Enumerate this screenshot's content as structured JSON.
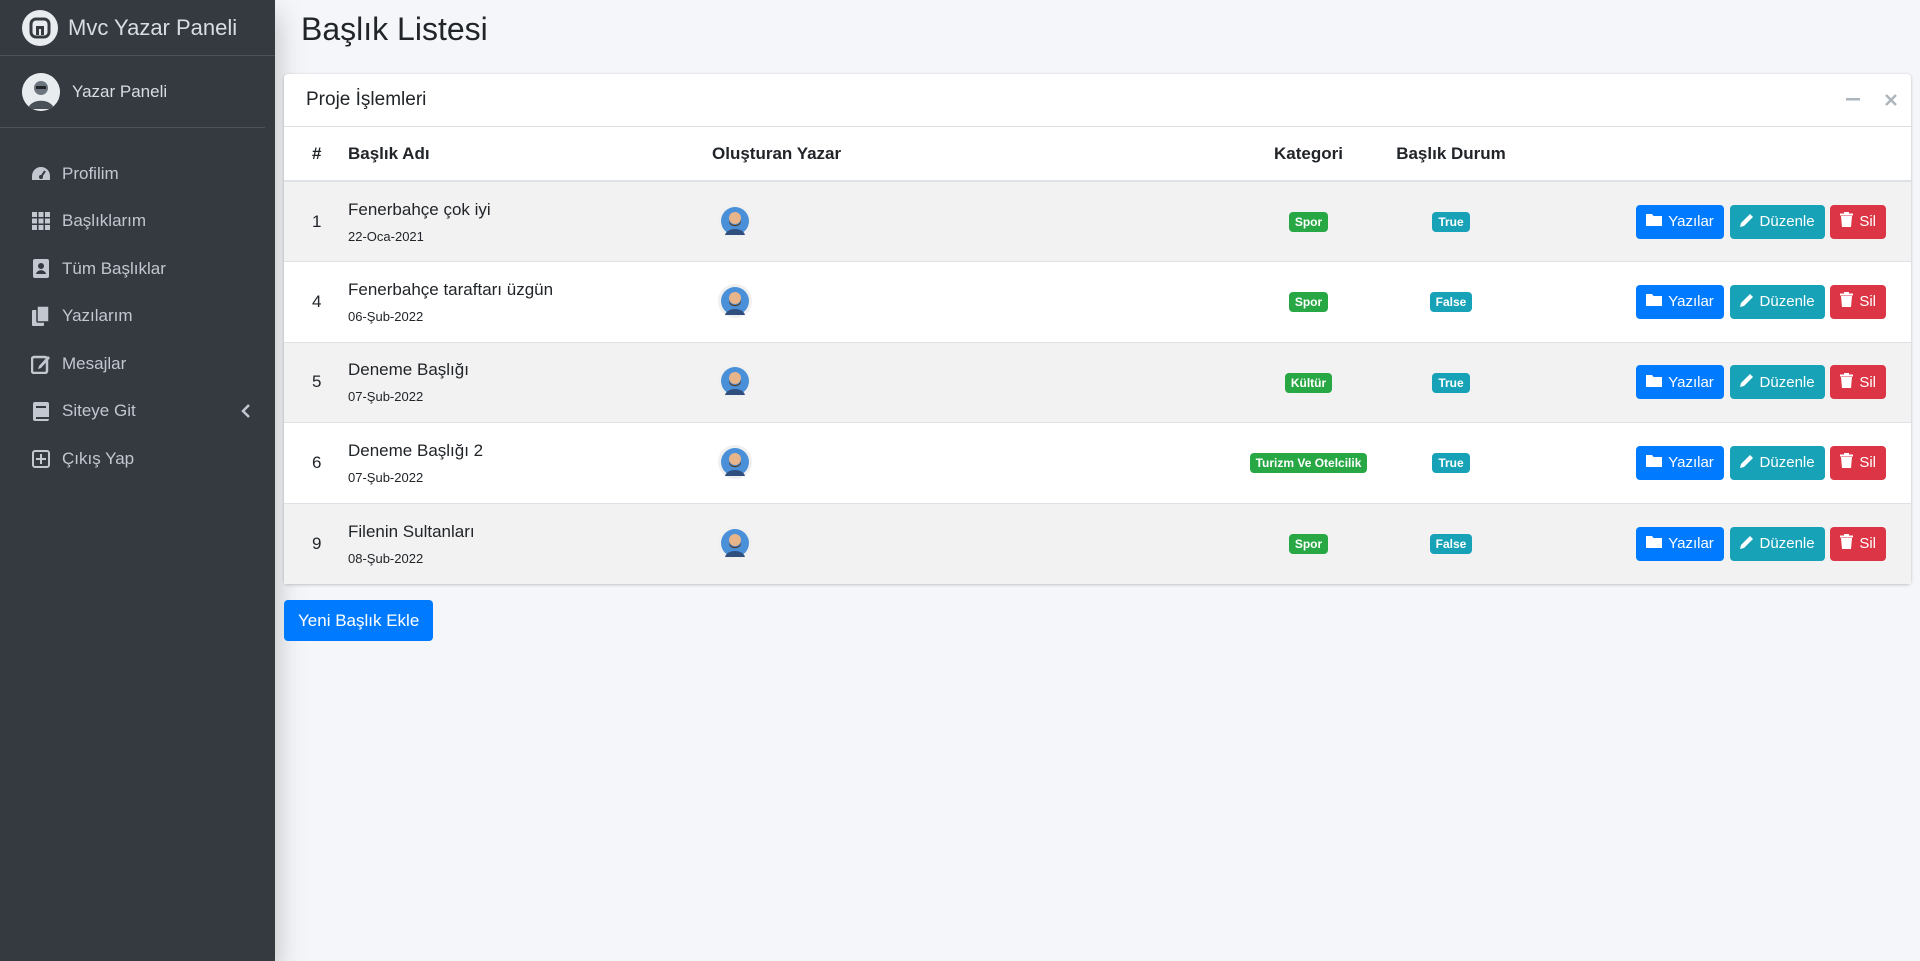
{
  "brand": {
    "title": "Mvc Yazar Paneli",
    "logo_icon": "brand-logo-icon"
  },
  "user": {
    "name": "Yazar Paneli",
    "avatar_icon": "user-avatar"
  },
  "sidebar": {
    "items": [
      {
        "label": "Profilim",
        "icon": "tachometer-icon"
      },
      {
        "label": "Başlıklarım",
        "icon": "grid-icon"
      },
      {
        "label": "Tüm Başlıklar",
        "icon": "contact-book-icon"
      },
      {
        "label": "Yazılarım",
        "icon": "copy-icon"
      },
      {
        "label": "Mesajlar",
        "icon": "edit-icon"
      },
      {
        "label": "Siteye Git",
        "icon": "book-icon",
        "caret": "chevron-left-icon"
      },
      {
        "label": "Çıkış Yap",
        "icon": "plus-square-icon"
      }
    ]
  },
  "page": {
    "title": "Başlık Listesi"
  },
  "card": {
    "title": "Proje İşlemleri",
    "tools": [
      "minus-icon",
      "close-icon"
    ],
    "headers": [
      "#",
      "Başlık Adı",
      "Oluşturan Yazar",
      "Kategori",
      "Başlık Durum"
    ],
    "rows": [
      {
        "id": "1",
        "title": "Fenerbahçe çok iyi",
        "date": "22-Oca-2021",
        "category": "Spor",
        "status": "True"
      },
      {
        "id": "4",
        "title": "Fenerbahçe taraftarı üzgün",
        "date": "06-Şub-2022",
        "category": "Spor",
        "status": "False"
      },
      {
        "id": "5",
        "title": "Deneme Başlığı",
        "date": "07-Şub-2022",
        "category": "Kültür",
        "status": "True"
      },
      {
        "id": "6",
        "title": "Deneme Başlığı 2",
        "date": "07-Şub-2022",
        "category": "Turizm Ve Otelcilik",
        "status": "True"
      },
      {
        "id": "9",
        "title": "Filenin Sultanları",
        "date": "08-Şub-2022",
        "category": "Spor",
        "status": "False"
      }
    ],
    "actions": {
      "posts": "Yazılar",
      "edit": "Düzenle",
      "delete": "Sil"
    }
  },
  "new_button": "Yeni Başlık Ekle",
  "colors": {
    "sidebar": "#343a40",
    "primary": "#007bff",
    "info": "#17a2b8",
    "danger": "#dc3545",
    "success": "#28a745"
  }
}
